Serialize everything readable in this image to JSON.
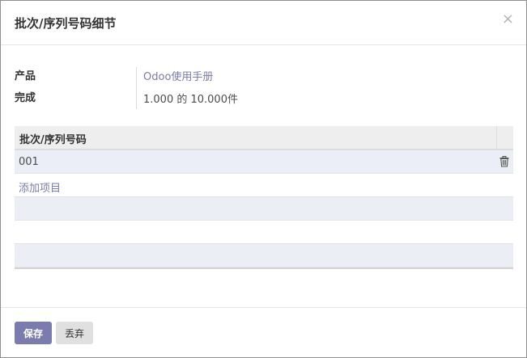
{
  "dialog": {
    "title": "批次/序列号码细节",
    "close_glyph": "×"
  },
  "fields": {
    "product_label": "产品",
    "product_value": "Odoo使用手册",
    "done_label": "完成",
    "done_value": "1.000 的 10.000件"
  },
  "table": {
    "column_header": "批次/序列号码",
    "rows": [
      {
        "lot": "001"
      }
    ],
    "add_line_label": "添加项目",
    "delete_icon": "trash-icon"
  },
  "footer": {
    "save_label": "保存",
    "discard_label": "丢弃"
  },
  "colors": {
    "accent": "#7c7bad",
    "header_bg": "#eeeeee",
    "row_stripe": "#eceef5"
  }
}
